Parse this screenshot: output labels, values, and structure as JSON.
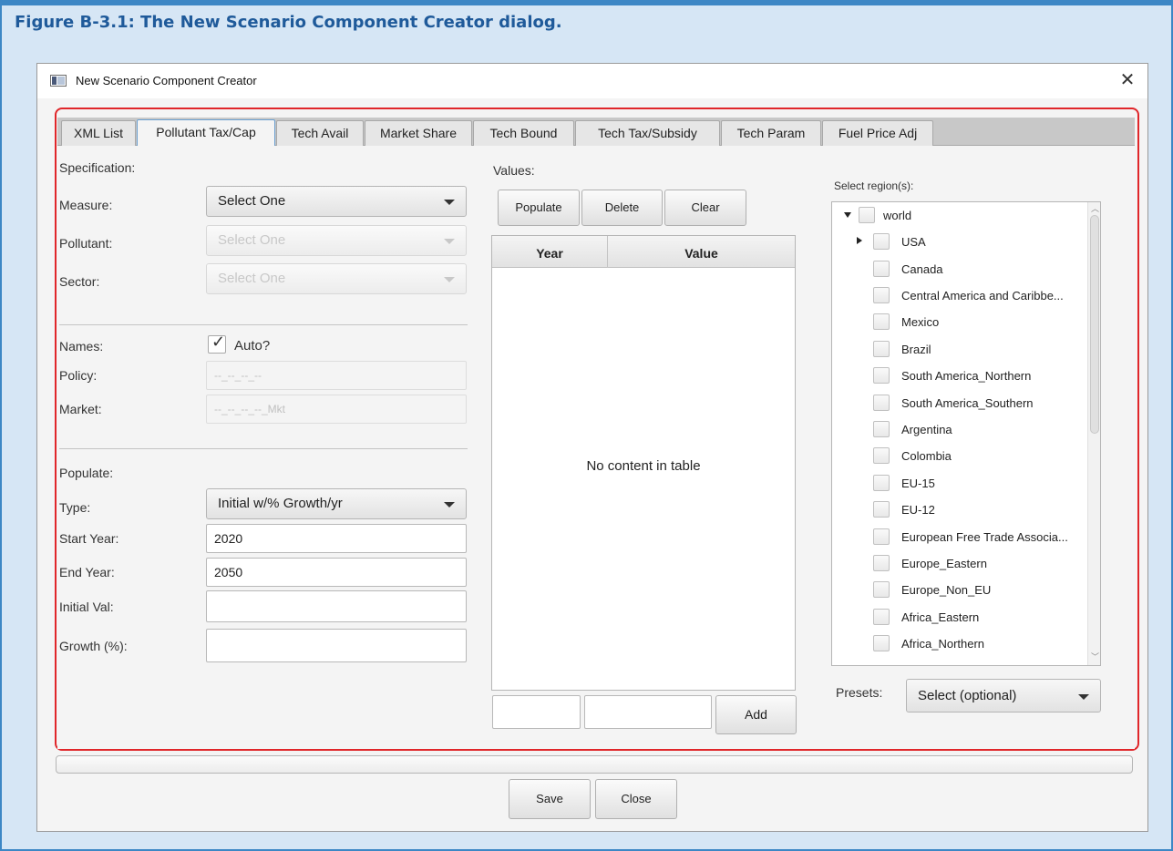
{
  "figure": {
    "caption": "Figure B-3.1: The New Scenario Component Creator dialog."
  },
  "window": {
    "title": "New Scenario Component Creator",
    "close_glyph": "✕"
  },
  "tabs": [
    {
      "label": "XML List"
    },
    {
      "label": "Pollutant Tax/Cap",
      "selected": true
    },
    {
      "label": "Tech Avail"
    },
    {
      "label": "Market Share"
    },
    {
      "label": "Tech Bound"
    },
    {
      "label": "Tech Tax/Subsidy"
    },
    {
      "label": "Tech Param"
    },
    {
      "label": "Fuel Price Adj"
    }
  ],
  "specification": {
    "header": "Specification:",
    "measure_label": "Measure:",
    "measure_value": "Select One",
    "pollutant_label": "Pollutant:",
    "pollutant_value": "Select One",
    "sector_label": "Sector:",
    "sector_value": "Select One"
  },
  "names": {
    "label": "Names:",
    "auto_label": "Auto?",
    "auto_checked": true,
    "policy_label": "Policy:",
    "policy_value": "--_--_--_--",
    "market_label": "Market:",
    "market_value": "--_--_--_--_Mkt"
  },
  "populate": {
    "header": "Populate:",
    "type_label": "Type:",
    "type_value": "Initial w/% Growth/yr",
    "start_year_label": "Start Year:",
    "start_year_value": "2020",
    "end_year_label": "End Year:",
    "end_year_value": "2050",
    "initial_val_label": "Initial Val:",
    "initial_val_value": "",
    "growth_label": "Growth (%):",
    "growth_value": ""
  },
  "values": {
    "header": "Values:",
    "populate_btn": "Populate",
    "delete_btn": "Delete",
    "clear_btn": "Clear",
    "col_year": "Year",
    "col_value": "Value",
    "empty_message": "No content in table",
    "add_btn": "Add"
  },
  "regions": {
    "header": "Select region(s):",
    "items": [
      {
        "label": "world",
        "expander": "expanded",
        "level": 0
      },
      {
        "label": "USA",
        "expander": "collapsed",
        "level": 1
      },
      {
        "label": "Canada",
        "level": 1
      },
      {
        "label": "Central America and Caribbe...",
        "level": 1
      },
      {
        "label": "Mexico",
        "level": 1
      },
      {
        "label": "Brazil",
        "level": 1
      },
      {
        "label": "South America_Northern",
        "level": 1
      },
      {
        "label": "South America_Southern",
        "level": 1
      },
      {
        "label": "Argentina",
        "level": 1
      },
      {
        "label": "Colombia",
        "level": 1
      },
      {
        "label": "EU-15",
        "level": 1
      },
      {
        "label": "EU-12",
        "level": 1
      },
      {
        "label": "European Free Trade Associa...",
        "level": 1
      },
      {
        "label": "Europe_Eastern",
        "level": 1
      },
      {
        "label": "Europe_Non_EU",
        "level": 1
      },
      {
        "label": "Africa_Eastern",
        "level": 1
      },
      {
        "label": "Africa_Northern",
        "level": 1
      }
    ],
    "presets_label": "Presets:",
    "presets_value": "Select (optional)"
  },
  "footer": {
    "save_btn": "Save",
    "close_btn": "Close"
  }
}
